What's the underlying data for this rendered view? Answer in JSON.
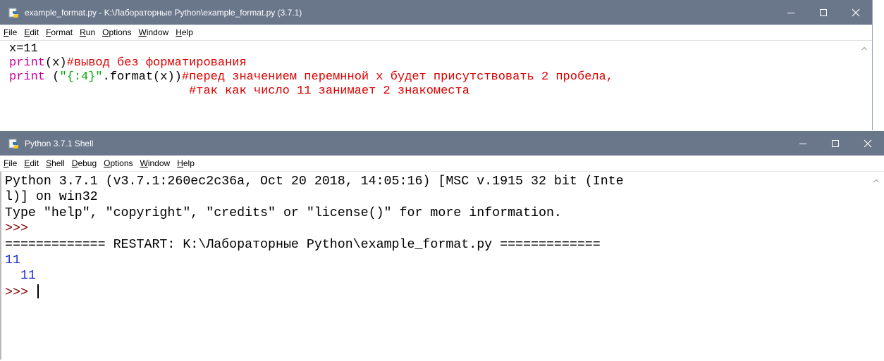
{
  "editor": {
    "title": "example_format.py - K:\\Лабораторные Python\\example_format.py (3.7.1)",
    "menu": [
      "File",
      "Edit",
      "Format",
      "Run",
      "Options",
      "Window",
      "Help"
    ],
    "line1": "x=11",
    "line2_kw": "print",
    "line2_rest": "(x)",
    "line2_comment": "#вывод без форматирования",
    "line3_kw": "print",
    "line3_paren": " (",
    "line3_str": "\"{:4}\"",
    "line3_rest": ".format(x))",
    "line3_comment": "#перед значением перемнной х будет присутствовать 2 пробела,",
    "line4_comment": "#так как число 11 занимает 2 знакоместа"
  },
  "shell": {
    "title": "Python 3.7.1 Shell",
    "menu": [
      "File",
      "Edit",
      "Shell",
      "Debug",
      "Options",
      "Window",
      "Help"
    ],
    "line1": "Python 3.7.1 (v3.7.1:260ec2c36a, Oct 20 2018, 14:05:16) [MSC v.1915 32 bit (Inte",
    "line2": "l)] on win32",
    "line3": "Type \"help\", \"copyright\", \"credits\" or \"license()\" for more information.",
    "prompt1": ">>>",
    "restart": "============= RESTART: K:\\Лабораторные Python\\example_format.py =============",
    "out1": "11",
    "out2": "  11",
    "prompt2": ">>>"
  },
  "colors": {
    "titlebar": "#6a778b",
    "keyword": "#c8009d",
    "comment": "#dd0000",
    "string": "#00aa00",
    "output": "#1f2fd8",
    "prompt": "#8b0000"
  },
  "icons": [
    "python-icon",
    "minimize-icon",
    "maximize-icon",
    "close-icon",
    "scroll-up-icon"
  ]
}
